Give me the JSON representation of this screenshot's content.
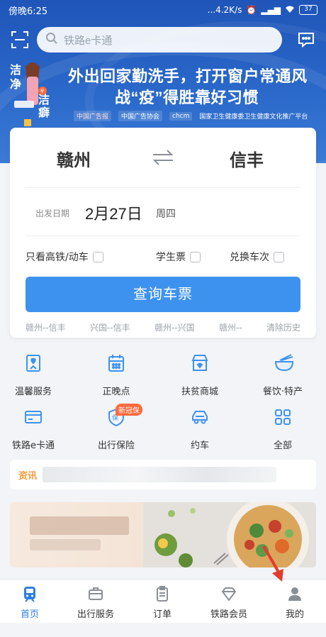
{
  "status_bar": {
    "time": "傍晚6:25",
    "network_speed": "...4.2K/s",
    "battery": "37"
  },
  "search": {
    "placeholder": "铁路e卡通"
  },
  "banner": {
    "line1": "外出回家勤洗手，打开窗户常通风",
    "line2": "战“疫”得胜靠好习惯",
    "figure_text": "洁净 洁癖",
    "partners": [
      "中国广告协会",
      "国家卫生健康委卫生健康文化推广平台"
    ]
  },
  "ticket": {
    "from": "赣州",
    "to": "信丰",
    "date_label": "出发日期",
    "date": "2月27日",
    "weekday": "周四",
    "options": [
      {
        "label": "只看高铁/动车",
        "checked": false
      },
      {
        "label": "学生票",
        "checked": false
      },
      {
        "label": "兑换车次",
        "checked": false
      }
    ],
    "query_button": "查询车票",
    "history": [
      "赣州--信丰",
      "兴国--信丰",
      "赣州--兴国",
      "赣州--"
    ],
    "clear_history": "清除历史"
  },
  "services": [
    {
      "label": "温馨服务",
      "icon": "heart-doc-icon"
    },
    {
      "label": "正晚点",
      "icon": "calendar-icon"
    },
    {
      "label": "扶贫商城",
      "icon": "shop-icon"
    },
    {
      "label": "餐饮·特产",
      "icon": "noodle-bowl-icon"
    },
    {
      "label": "铁路e卡通",
      "icon": "card-icon"
    },
    {
      "label": "出行保险",
      "icon": "shield-icon",
      "badge": "新冠保"
    },
    {
      "label": "约车",
      "icon": "car-icon"
    },
    {
      "label": "全部",
      "icon": "grid-icon"
    }
  ],
  "news": {
    "tag": "资讯"
  },
  "bottom_nav": [
    {
      "label": "首页",
      "icon": "train-icon",
      "active": true
    },
    {
      "label": "出行服务",
      "icon": "suitcase-icon",
      "active": false
    },
    {
      "label": "订单",
      "icon": "clipboard-icon",
      "active": false
    },
    {
      "label": "铁路会员",
      "icon": "diamond-icon",
      "active": false
    },
    {
      "label": "我的",
      "icon": "person-icon",
      "active": false
    }
  ],
  "colors": {
    "primary": "#3e92ef",
    "header": "#2a68c9",
    "accent_orange": "#f29b3b",
    "badge": "#ff6a3d",
    "arrow": "#e53b2e"
  }
}
